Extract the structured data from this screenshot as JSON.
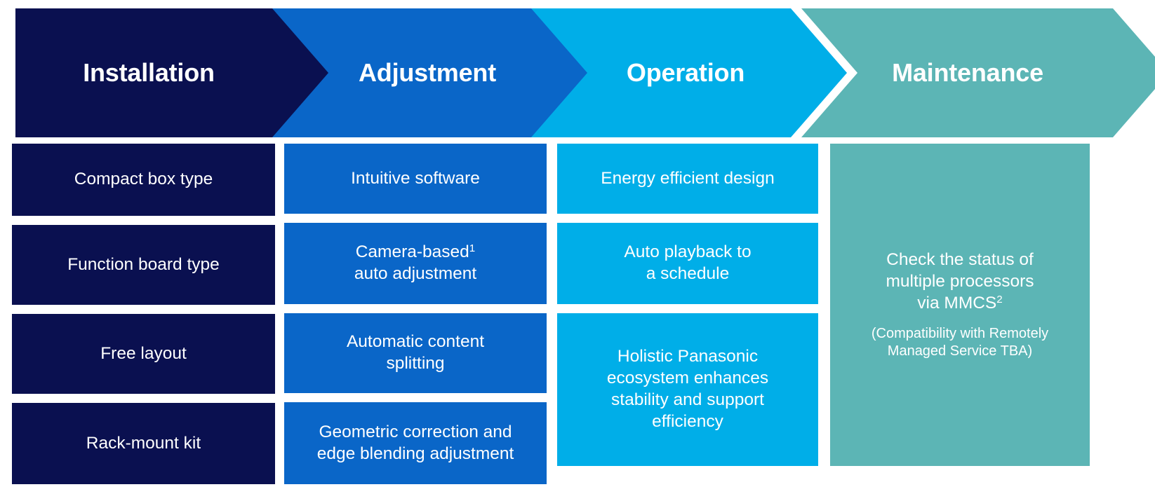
{
  "colors": {
    "installation": "#0A1050",
    "adjustment": "#0A66C8",
    "operation": "#00AEE8",
    "maintenance": "#5CB5B5",
    "background": "#FFFFFF",
    "text_on_color": "#FFFFFF"
  },
  "process": {
    "stages": [
      {
        "key": "installation",
        "title": "Installation",
        "color": "#0A1050",
        "shape": "chevron-flat-left",
        "cards": [
          {
            "text": "Compact box type"
          },
          {
            "text": "Function board type"
          },
          {
            "text": "Free layout"
          },
          {
            "text": "Rack-mount kit"
          }
        ]
      },
      {
        "key": "adjustment",
        "title": "Adjustment",
        "color": "#0A66C8",
        "shape": "chevron-notched",
        "cards": [
          {
            "text": "Intuitive software"
          },
          {
            "text": "Camera-based",
            "sup": "1",
            "text_after": "\nauto adjustment"
          },
          {
            "text": "Automatic content\nsplitting"
          },
          {
            "text": "Geometric correction and\nedge blending adjustment"
          }
        ]
      },
      {
        "key": "operation",
        "title": "Operation",
        "color": "#00AEE8",
        "shape": "chevron-notched",
        "cards": [
          {
            "text": "Energy efficient design"
          },
          {
            "text": "Auto playback to\na schedule"
          },
          {
            "text": "Holistic Panasonic\necosystem enhances\nstability and support\nefficiency"
          }
        ]
      },
      {
        "key": "maintenance",
        "title": "Maintenance",
        "color": "#5CB5B5",
        "shape": "chevron-notched",
        "cards": [
          {
            "text": "Check the status of\nmultiple processors\nvia MMCS",
            "sup": "2",
            "subtext": "(Compatibility with Remotely\nManaged Service TBA)"
          }
        ]
      }
    ]
  }
}
